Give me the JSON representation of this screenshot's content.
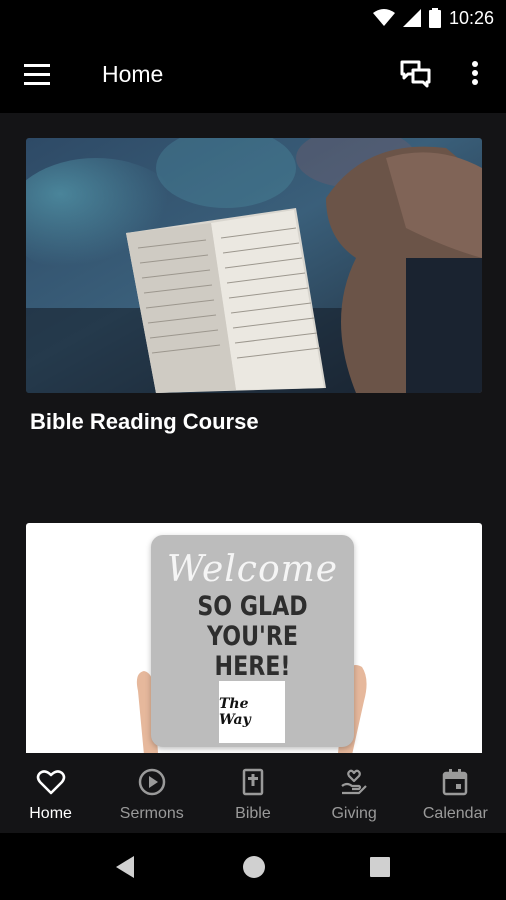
{
  "status_bar": {
    "time": "10:26"
  },
  "app_bar": {
    "title": "Home"
  },
  "cards": [
    {
      "title": "Bible Reading Course"
    },
    {
      "sign": {
        "welcome": "Welcome",
        "lines": [
          "SO GLAD",
          "YOU'RE",
          "HERE!"
        ],
        "logo_text": "The Way"
      }
    }
  ],
  "bottom_nav": {
    "active": "Home",
    "items": [
      {
        "label": "Home",
        "icon": "heart-icon"
      },
      {
        "label": "Sermons",
        "icon": "play-circle-icon"
      },
      {
        "label": "Bible",
        "icon": "bible-icon"
      },
      {
        "label": "Giving",
        "icon": "giving-hand-icon"
      },
      {
        "label": "Calendar",
        "icon": "calendar-icon"
      }
    ]
  },
  "colors": {
    "background": "#141416",
    "bar": "#000000",
    "inactive": "#9a9a9a",
    "active": "#ffffff"
  }
}
